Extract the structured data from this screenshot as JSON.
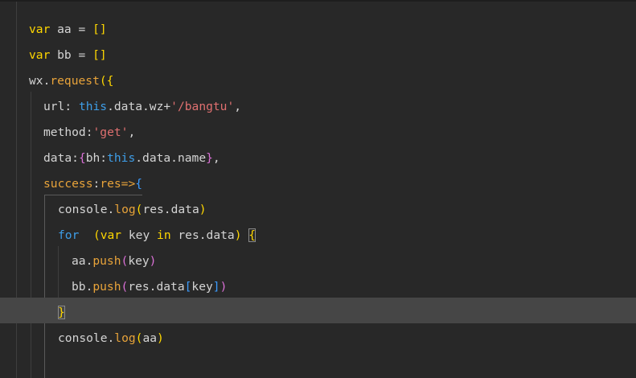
{
  "editor": {
    "lines": [
      {
        "tokens": [
          {
            "t": "var",
            "c": "tok-br1"
          },
          {
            "t": " aa = ",
            "c": "tok-id"
          },
          {
            "t": "[]",
            "c": "tok-br1"
          }
        ]
      },
      {
        "tokens": [
          {
            "t": "var",
            "c": "tok-br1"
          },
          {
            "t": " bb = ",
            "c": "tok-id"
          },
          {
            "t": "[]",
            "c": "tok-br1"
          }
        ]
      },
      {
        "tokens": [
          {
            "t": "wx.",
            "c": "tok-id"
          },
          {
            "t": "request",
            "c": "tok-fn"
          },
          {
            "t": "({",
            "c": "tok-br1"
          }
        ]
      },
      {
        "tokens": [
          {
            "t": "url: ",
            "c": "tok-id"
          },
          {
            "t": "this",
            "c": "tok-this"
          },
          {
            "t": ".data.wz+",
            "c": "tok-id"
          },
          {
            "t": "'/bangtu'",
            "c": "tok-str"
          },
          {
            "t": ",",
            "c": "tok-pun"
          }
        ]
      },
      {
        "tokens": [
          {
            "t": "method:",
            "c": "tok-id"
          },
          {
            "t": "'get'",
            "c": "tok-str"
          },
          {
            "t": ",",
            "c": "tok-pun"
          }
        ]
      },
      {
        "tokens": [
          {
            "t": "data:",
            "c": "tok-id"
          },
          {
            "t": "{",
            "c": "tok-br2"
          },
          {
            "t": "bh:",
            "c": "tok-id"
          },
          {
            "t": "this",
            "c": "tok-this"
          },
          {
            "t": ".data.name",
            "c": "tok-id"
          },
          {
            "t": "}",
            "c": "tok-br2"
          },
          {
            "t": ",",
            "c": "tok-pun"
          }
        ]
      },
      {
        "tokens": [
          {
            "t": "success",
            "c": "tok-fn"
          },
          {
            "t": ":",
            "c": "tok-id"
          },
          {
            "t": "res",
            "c": "tok-fn"
          },
          {
            "t": "=>",
            "c": "tok-fn"
          },
          {
            "t": "{",
            "c": "tok-br3"
          }
        ]
      },
      {
        "tokens": [
          {
            "t": "console.",
            "c": "tok-id"
          },
          {
            "t": "log",
            "c": "tok-fn"
          },
          {
            "t": "(",
            "c": "tok-br1"
          },
          {
            "t": "res.data",
            "c": "tok-id"
          },
          {
            "t": ")",
            "c": "tok-br1"
          }
        ]
      },
      {
        "tokens": [
          {
            "t": "for",
            "c": "tok-kw"
          },
          {
            "t": "  ",
            "c": "tok-id"
          },
          {
            "t": "(",
            "c": "tok-br1"
          },
          {
            "t": "var",
            "c": "tok-br1"
          },
          {
            "t": " key ",
            "c": "tok-id"
          },
          {
            "t": "in",
            "c": "tok-br1"
          },
          {
            "t": " res.data",
            "c": "tok-id"
          },
          {
            "t": ")",
            "c": "tok-br1"
          },
          {
            "t": " ",
            "c": "tok-id"
          },
          {
            "t": "{",
            "c": "tok-br1",
            "box": true
          }
        ]
      },
      {
        "tokens": [
          {
            "t": "aa.",
            "c": "tok-id"
          },
          {
            "t": "push",
            "c": "tok-fn"
          },
          {
            "t": "(",
            "c": "tok-br2"
          },
          {
            "t": "key",
            "c": "tok-id"
          },
          {
            "t": ")",
            "c": "tok-br2"
          }
        ]
      },
      {
        "tokens": [
          {
            "t": "bb.",
            "c": "tok-id"
          },
          {
            "t": "push",
            "c": "tok-fn"
          },
          {
            "t": "(",
            "c": "tok-br2"
          },
          {
            "t": "res.data",
            "c": "tok-id"
          },
          {
            "t": "[",
            "c": "tok-br3"
          },
          {
            "t": "key",
            "c": "tok-id"
          },
          {
            "t": "]",
            "c": "tok-br3"
          },
          {
            "t": ")",
            "c": "tok-br2"
          }
        ]
      },
      {
        "tokens": [
          {
            "t": "}",
            "c": "tok-br1",
            "box": true
          }
        ]
      },
      {
        "tokens": [
          {
            "t": "console.",
            "c": "tok-id"
          },
          {
            "t": "log",
            "c": "tok-fn"
          },
          {
            "t": "(",
            "c": "tok-br1"
          },
          {
            "t": "aa",
            "c": "tok-id"
          },
          {
            "t": ")",
            "c": "tok-br1"
          }
        ]
      }
    ]
  }
}
